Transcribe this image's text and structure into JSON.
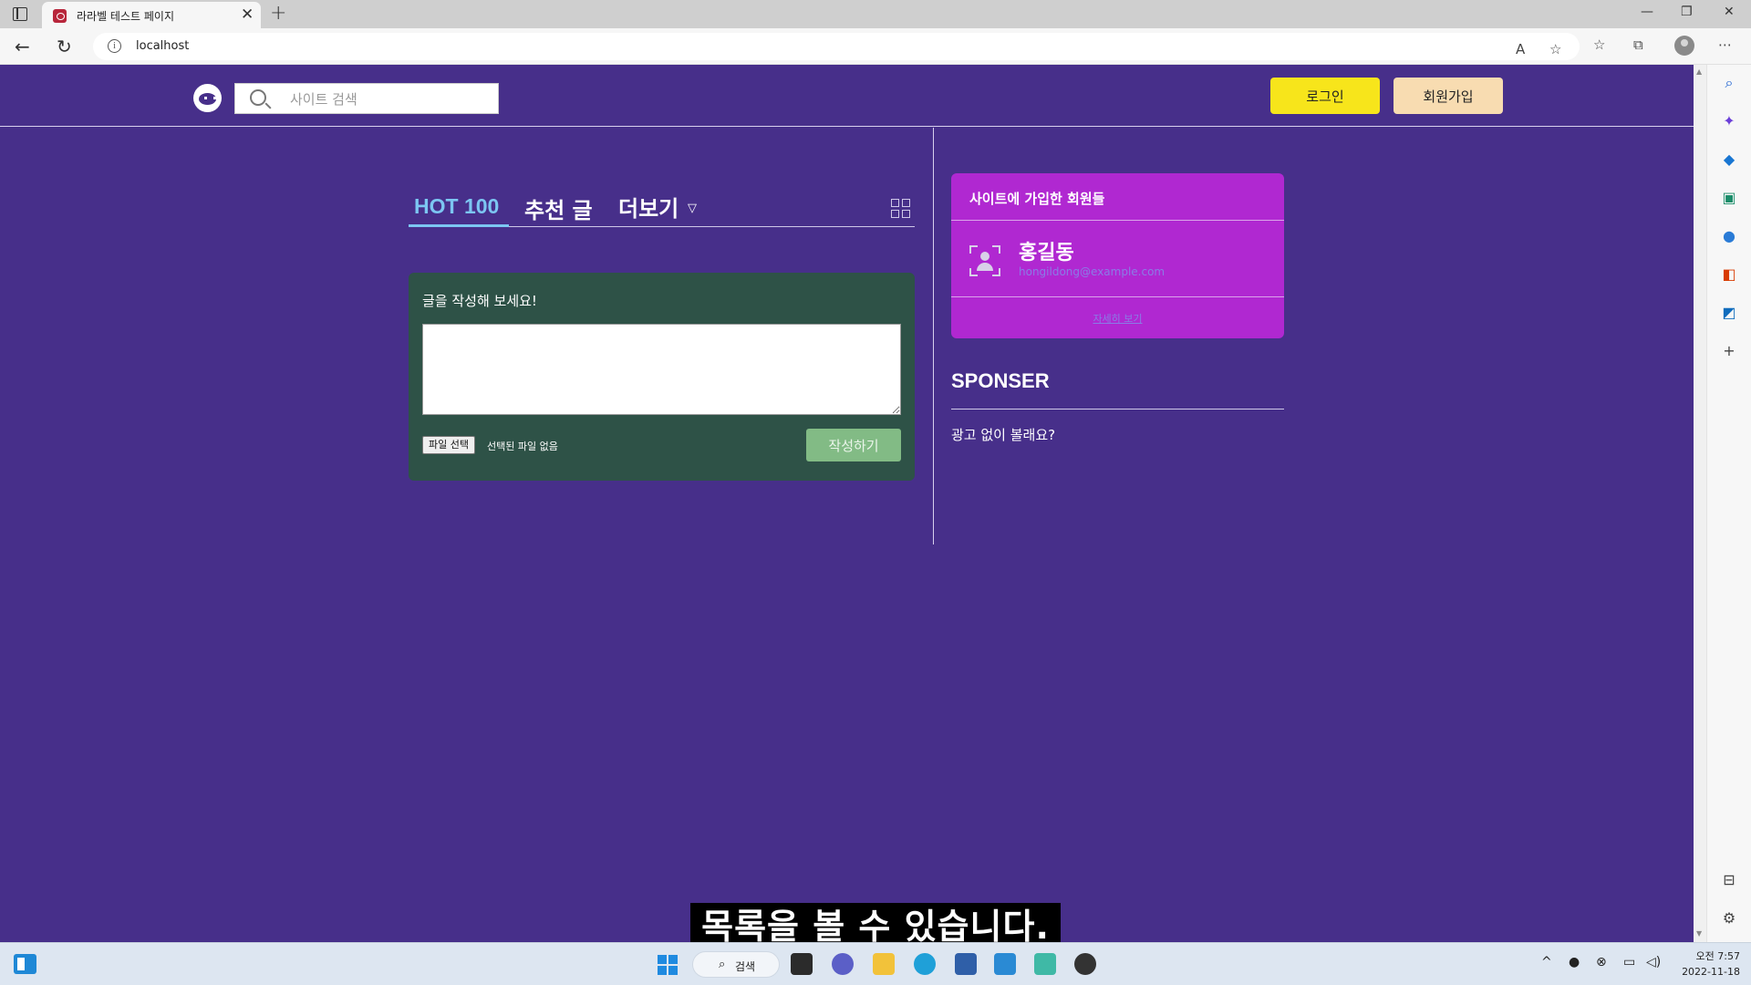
{
  "browser": {
    "tab_title": "라라벨 테스트 페이지",
    "tab_close": "✕",
    "new_tab": "+",
    "url": "localhost",
    "window_minimize": "—",
    "window_restore": "❐",
    "window_close": "✕"
  },
  "header": {
    "search_placeholder": "사이트 검색",
    "login_label": "로그인",
    "join_label": "회원가입"
  },
  "tabs": {
    "hot": "HOT 100",
    "recommended": "추천 글",
    "more": "더보기",
    "more_chevron": "▽"
  },
  "composer": {
    "title": "글을 작성해 보세요!",
    "text_value": "",
    "file_button": "파일 선택",
    "file_status": "선택된 파일 없음",
    "submit_label": "작성하기"
  },
  "members": {
    "title": "사이트에 가입한 회원들",
    "member_name": "홍길동",
    "member_email": "hongildong@example.com",
    "more_link": "자세히 보기"
  },
  "sponser": {
    "title": "SPONSER",
    "text": "광고 없이 볼래요?"
  },
  "caption": "목록을 볼 수 있습니다.",
  "taskbar": {
    "search_label": "검색",
    "clock_time": "오전 7:57",
    "clock_date": "2022-11-18"
  },
  "colors": {
    "page_bg": "#472f8a",
    "login_button": "#f7e51b",
    "join_button": "#f8dcb1",
    "composer_bg": "#2e5247",
    "submit_button": "#82bb85",
    "members_bg": "#b028d1",
    "hot_tab": "#7cc6f2"
  }
}
